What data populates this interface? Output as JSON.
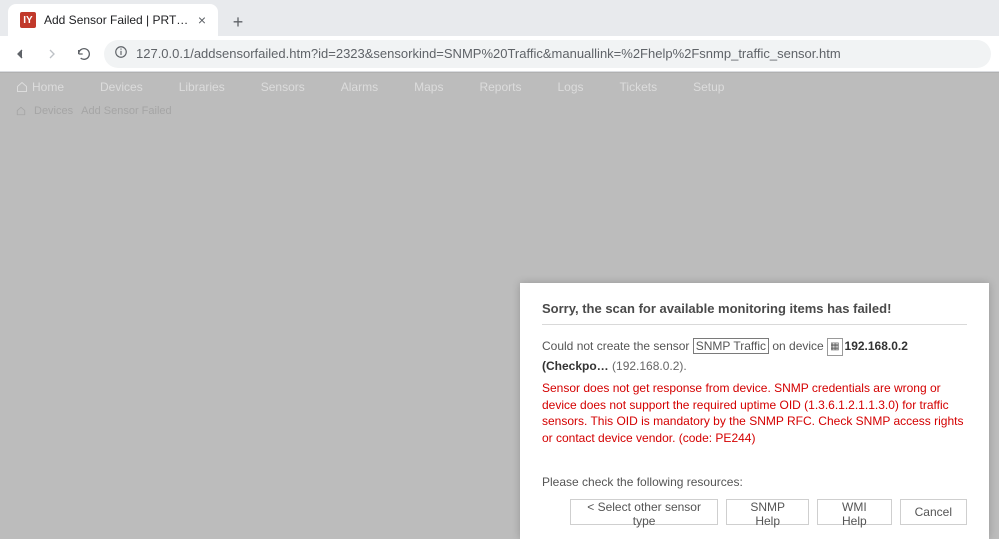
{
  "browser": {
    "tab_title": "Add Sensor Failed | PRTG Networ",
    "url": "127.0.0.1/addsensorfailed.htm?id=2323&sensorkind=SNMP%20Traffic&manuallink=%2Fhelp%2Fsnmp_traffic_sensor.htm"
  },
  "nav": {
    "items": [
      "Home",
      "Devices",
      "Libraries",
      "Sensors",
      "Alarms",
      "Maps",
      "Reports",
      "Logs",
      "Tickets",
      "Setup"
    ]
  },
  "breadcrumb": {
    "a": "Devices",
    "b": "Add Sensor Failed"
  },
  "dialog": {
    "title": "Sorry, the scan for available monitoring items has failed!",
    "could_not_pre": "Could not create the sensor ",
    "sensor_name": "SNMP Traffic",
    "on_device": " on device ",
    "device_name": "192.168.0.2 (Checkpo…",
    "device_ip": " (192.168.0.2).",
    "error": "Sensor does not get response from device. SNMP credentials are wrong or device does not support the required uptime OID (1.3.6.1.2.1.1.3.0) for traffic sensors. This OID is mandatory by the SNMP RFC. Check SNMP access rights or contact device vendor. (code: PE244)",
    "check": "Please check the following resources:",
    "buttons": {
      "select": "< Select other sensor type",
      "snmp": "SNMP Help",
      "wmi": "WMI Help",
      "cancel": "Cancel"
    }
  }
}
